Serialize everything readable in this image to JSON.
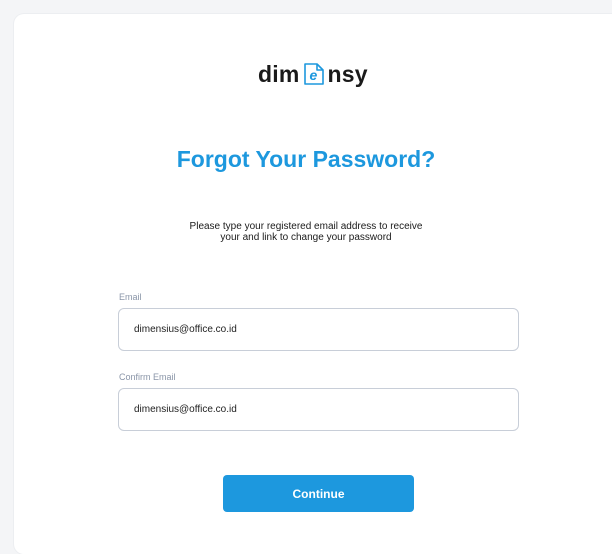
{
  "logo": {
    "prefix": "dim",
    "suffix": "nsy",
    "mark_icon": "logo-e-icon",
    "mark_color": "#1d98de"
  },
  "title": "Forgot Your Password?",
  "subtitle_line1": "Please type your registered email address to receive",
  "subtitle_line2": "your and link to change your password",
  "email": {
    "label": "Email",
    "value": "dimensius@office.co.id"
  },
  "confirm_email": {
    "label": "Confirm Email",
    "value": "dimensius@office.co.id"
  },
  "continue_label": "Continue",
  "colors": {
    "accent": "#1d98de",
    "label": "#8a95a8",
    "border": "#c8ced8"
  }
}
